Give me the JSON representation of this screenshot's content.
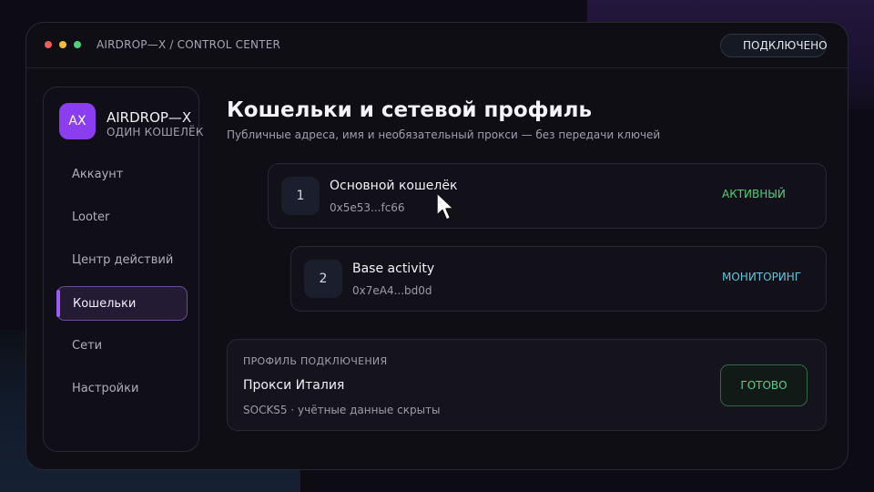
{
  "window": {
    "app_title": "AIRDROP—X / CONTROL CENTER",
    "connection_status": "ПОДКЛЮЧЕНО"
  },
  "sidebar": {
    "avatar_initials": "AX",
    "brand_name": "AIRDROP—X",
    "brand_subtitle": "ОДИН КОШЕЛЁК",
    "items": [
      {
        "label": "Аккаунт",
        "active": false
      },
      {
        "label": "Looter",
        "active": false
      },
      {
        "label": "Центр действий",
        "active": false
      },
      {
        "label": "Кошельки",
        "active": true
      },
      {
        "label": "Сети",
        "active": false
      },
      {
        "label": "Настройки",
        "active": false
      }
    ]
  },
  "main": {
    "title": "Кошельки и сетевой профиль",
    "subtitle": "Публичные адреса, имя и необязательный прокси — без передачи ключей",
    "wallets": [
      {
        "index": "1",
        "name": "Основной кошелёк",
        "address": "0x5e53...fc66",
        "status": "АКТИВНЫЙ",
        "status_color": "#4fcf7a"
      },
      {
        "index": "2",
        "name": "Base activity",
        "address": "0x7eA4...bd0d",
        "status": "МОНИТОРИНГ",
        "status_color": "#5cc6de"
      }
    ],
    "profile": {
      "label": "ПРОФИЛЬ ПОДКЛЮЧЕНИЯ",
      "name": "Прокси Италия",
      "detail": "SOCKS5 · учётные данные скрыты",
      "button_label": "ГОТОВО"
    }
  },
  "colors": {
    "accent": "#8b3ef0",
    "success": "#4fd27e",
    "info": "#5cc6de"
  },
  "icons": {
    "cursor": "mouse-pointer-icon",
    "status": "status-dot-icon"
  }
}
